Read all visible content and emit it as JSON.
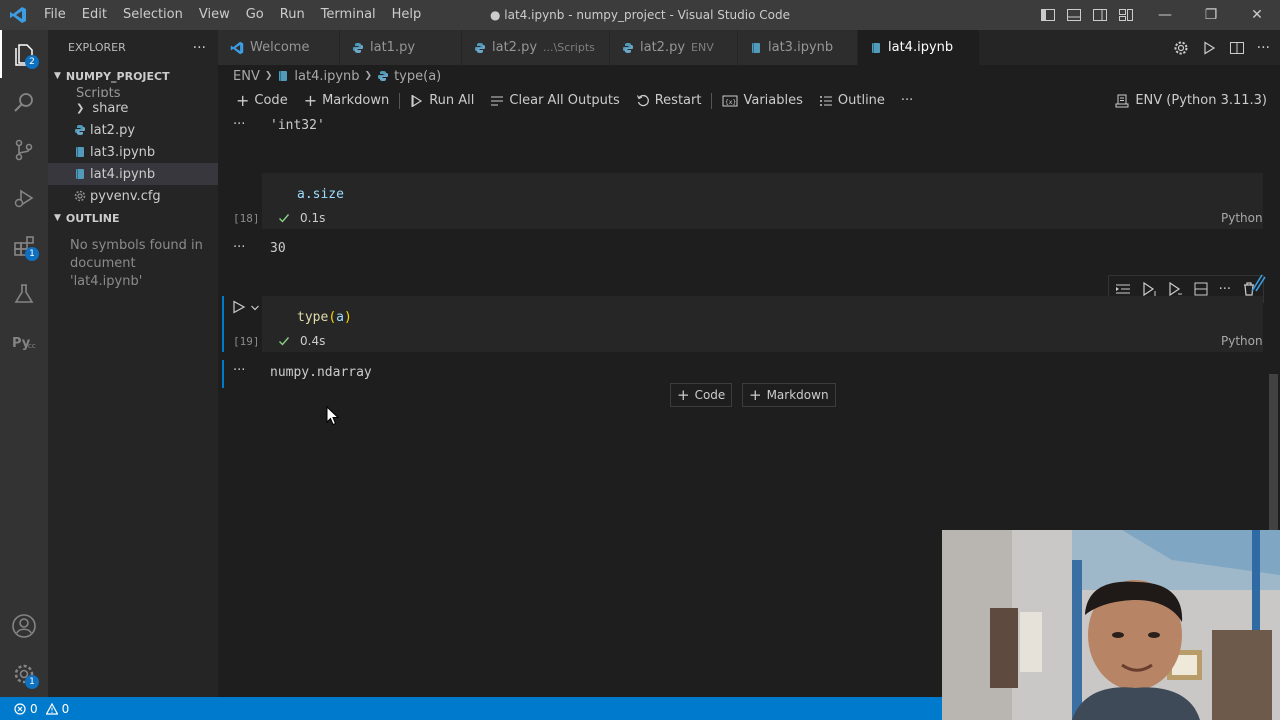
{
  "titlebar": {
    "menu": [
      "File",
      "Edit",
      "Selection",
      "View",
      "Go",
      "Run",
      "Terminal",
      "Help"
    ],
    "title": "● lat4.ipynb - numpy_project - Visual Studio Code"
  },
  "activity_badges": {
    "explorer": "2",
    "extensions": "1",
    "manage": "1"
  },
  "sidebar": {
    "header": "EXPLORER",
    "project": "NUMPY_PROJECT",
    "items": [
      {
        "label": "Scripts"
      },
      {
        "label": "share"
      },
      {
        "label": "lat2.py"
      },
      {
        "label": "lat3.ipynb"
      },
      {
        "label": "lat4.ipynb"
      },
      {
        "label": "pyvenv.cfg"
      }
    ],
    "outline_title": "OUTLINE",
    "outline_empty": "No symbols found in document 'lat4.ipynb'"
  },
  "tabs": [
    {
      "label": "Welcome",
      "desc": ""
    },
    {
      "label": "lat1.py",
      "desc": ""
    },
    {
      "label": "lat2.py",
      "desc": "...\\Scripts"
    },
    {
      "label": "lat2.py",
      "desc": "ENV"
    },
    {
      "label": "lat3.ipynb",
      "desc": ""
    },
    {
      "label": "lat4.ipynb",
      "desc": ""
    }
  ],
  "breadcrumb": [
    "ENV",
    "lat4.ipynb",
    "type(a)"
  ],
  "toolbar": {
    "code": "Code",
    "markdown": "Markdown",
    "run_all": "Run All",
    "clear_outputs": "Clear All Outputs",
    "restart": "Restart",
    "variables": "Variables",
    "outline": "Outline",
    "more": "···",
    "kernel": "ENV (Python 3.11.3)"
  },
  "cells": [
    {
      "output": "'int32'"
    },
    {
      "code": "a.size",
      "exec": "[18]",
      "time": "0.1s",
      "lang": "Python",
      "output": "30"
    },
    {
      "code_fn": "type",
      "code_open": "(",
      "code_arg": "a",
      "code_close": ")",
      "exec": "[19]",
      "time": "0.4s",
      "lang": "Python",
      "output": "numpy.ndarray"
    }
  ],
  "ellipsis": "···",
  "add_cell": {
    "code": "Code",
    "markdown": "Markdown"
  },
  "statusbar": {
    "errors": "0",
    "warnings": "0"
  },
  "colors": {
    "accent": "#007acc",
    "editor_bg": "#1e1e1e",
    "sidebar_bg": "#252526",
    "activity_bg": "#333333",
    "titlebar_bg": "#3c3c3c",
    "success": "#89d185"
  }
}
